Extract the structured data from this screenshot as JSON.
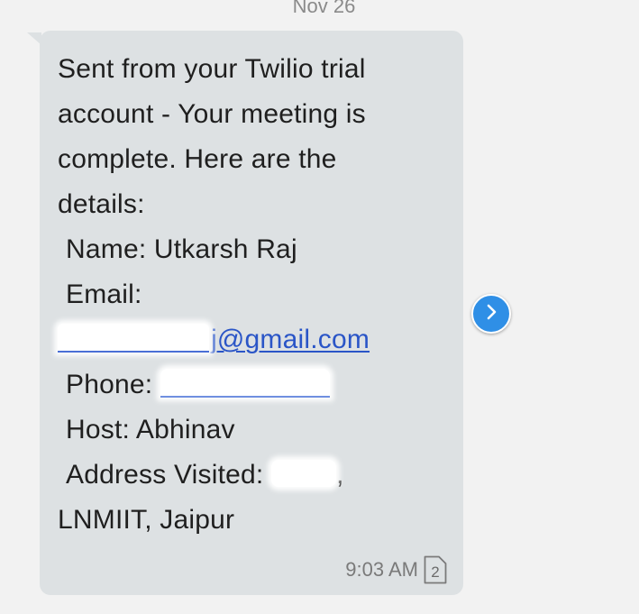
{
  "date_header": "Nov 26",
  "message": {
    "lines": {
      "l1": "Sent from your Twilio trial",
      "l2": "account - Your meeting is",
      "l3": "complete. Here are the",
      "l4": "details:",
      "l5": "Name: Utkarsh Raj",
      "l6": "Email:",
      "email_visible": "j@gmail.com",
      "phone_label": "Phone: ",
      "host": "Host: Abhinav",
      "address_label": "Address Visited: ",
      "address_suffix": ",",
      "address_line2": "LNMIIT, Jaipur"
    },
    "timestamp": "9:03 AM",
    "sim_slot": "2"
  },
  "icons": {
    "forward": "forward-arrow-icon",
    "sim": "sim-card-icon"
  },
  "colors": {
    "bubble": "#dde1e3",
    "link": "#2a55c7",
    "forward_button": "#2f8fe6",
    "background": "#f2f2f2"
  }
}
